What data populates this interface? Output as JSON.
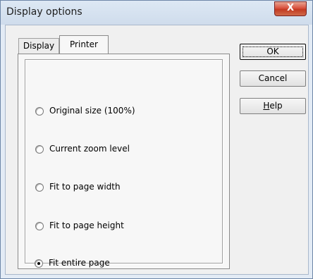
{
  "window": {
    "title": "Display options",
    "close_symbol": "X"
  },
  "tabs": [
    {
      "label": "Display",
      "selected": false
    },
    {
      "label": "Printer",
      "selected": true
    }
  ],
  "radio_options": [
    {
      "label": "Original size (100%)",
      "checked": false
    },
    {
      "label": "Current zoom level",
      "checked": false
    },
    {
      "label": "Fit to page width",
      "checked": false
    },
    {
      "label": "Fit to page height",
      "checked": false
    },
    {
      "label": "Fit entire page",
      "checked": true
    }
  ],
  "buttons": {
    "ok": "OK",
    "cancel": "Cancel",
    "help_mnemonic": "H",
    "help_rest": "elp"
  },
  "colors": {
    "accent_close": "#c23a22",
    "frame": "#e3ebf5",
    "dialog_bg": "#f0f0f0"
  }
}
